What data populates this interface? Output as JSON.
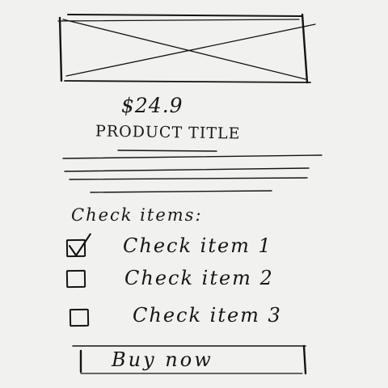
{
  "product": {
    "image_icon": "image-placeholder-icon",
    "price": "$24.9",
    "title": "PRODUCT TITLE"
  },
  "checklist": {
    "heading": "Check items:",
    "items": [
      {
        "label": "Check item 1",
        "checked": true
      },
      {
        "label": "Check item 2",
        "checked": false
      },
      {
        "label": "Check item 3",
        "checked": false
      }
    ]
  },
  "action": {
    "buy_label": "Buy now"
  },
  "colors": {
    "ink": "#141414",
    "paper": "#f1f1ef"
  }
}
